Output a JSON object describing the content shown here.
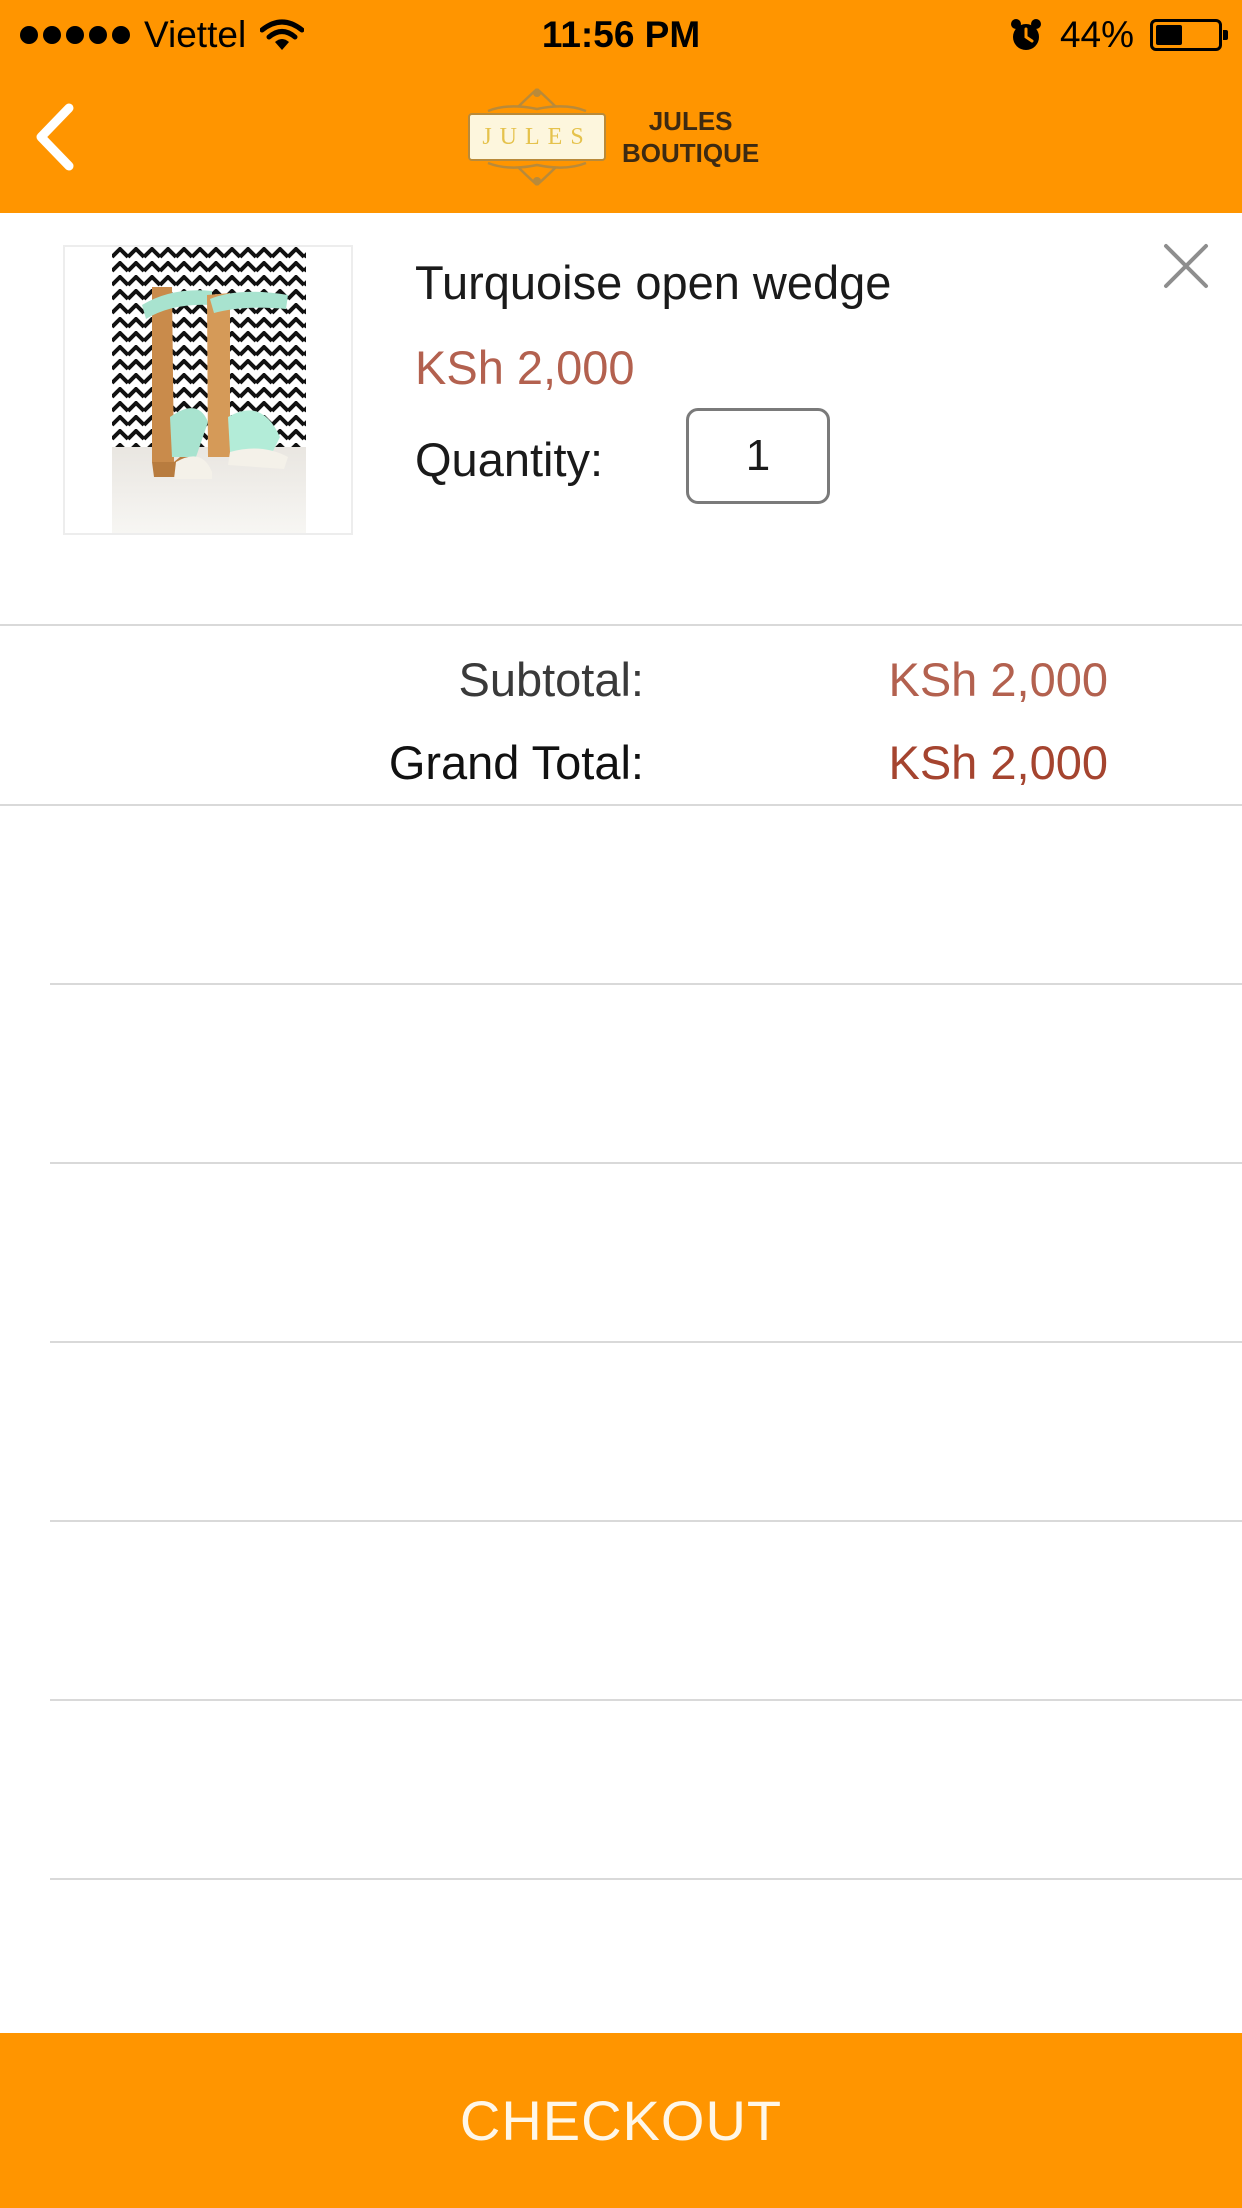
{
  "status_bar": {
    "carrier": "Viettel",
    "time": "11:56 PM",
    "battery_percent": "44%",
    "battery_level": 0.44,
    "signal_dots": 5
  },
  "header": {
    "logo_badge": "JULES",
    "logo_line1": "JULES",
    "logo_line2": "BOUTIQUE",
    "back_icon": "chevron-left-icon"
  },
  "cart": {
    "items": [
      {
        "name": "Turquoise open wedge",
        "price": "KSh 2,000",
        "quantity_label": "Quantity:",
        "quantity": "1",
        "remove_icon": "close-icon"
      }
    ]
  },
  "totals": {
    "subtotal_label": "Subtotal:",
    "subtotal_value": "KSh 2,000",
    "grand_total_label": "Grand Total:",
    "grand_total_value": "KSh 2,000"
  },
  "checkout": {
    "label": "CHECKOUT"
  },
  "colors": {
    "brand_orange": "#ff9500",
    "price": "#b3614f"
  }
}
